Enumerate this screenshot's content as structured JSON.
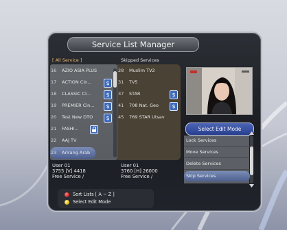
{
  "window": {
    "title": "Service List Manager"
  },
  "left_panel": {
    "header": "[ All Service ]",
    "rows": [
      {
        "num": "16",
        "name": "AZIO ASIA PLUS",
        "badge": ""
      },
      {
        "num": "17",
        "name": "ACTION Cin...",
        "badge": "$"
      },
      {
        "num": "18",
        "name": "CLASSIC Cl...",
        "badge": "$"
      },
      {
        "num": "19",
        "name": "PREMIER Cin...",
        "badge": "$"
      },
      {
        "num": "20",
        "name": "Test New DTO",
        "badge": "$"
      },
      {
        "num": "21",
        "name": "FASHI...",
        "badge": "lock"
      },
      {
        "num": "22",
        "name": "AAJ TV",
        "badge": ""
      },
      {
        "num": "23",
        "name": "Arirang Arab",
        "badge": ""
      }
    ],
    "info": {
      "line1": "User 01",
      "line2": "3755 [V] 4418",
      "line3": "Free Service /"
    }
  },
  "right_panel": {
    "header": "Skipped Services",
    "rows": [
      {
        "num": "28",
        "name": "Muslim TV2",
        "badge": ""
      },
      {
        "num": "31",
        "name": "TV5",
        "badge": ""
      },
      {
        "num": "37",
        "name": "STAR",
        "badge": "$"
      },
      {
        "num": "41",
        "name": "708 Nat. Geo",
        "badge": "$"
      },
      {
        "num": "45",
        "name": "769 STAR Utsav",
        "badge": ""
      }
    ],
    "info": {
      "line1": "User 01",
      "line2": "3760 [H] 26000",
      "line3": "Free Service /"
    }
  },
  "edit_mode": {
    "header": "Select Edit Mode",
    "items": [
      "Lock Services",
      "Move Services",
      "Delete Services",
      "Skip Services"
    ],
    "selected_index": 3
  },
  "legend": {
    "red_label": "Sort Lists [ A ~ Z ]",
    "yellow_label": "Select Edit Mode"
  },
  "colors": {
    "selection": "#5a6d9c",
    "red_key": "#d22a2a",
    "yellow_key": "#e6c21c",
    "badge_blue": "#3d6ab8"
  }
}
